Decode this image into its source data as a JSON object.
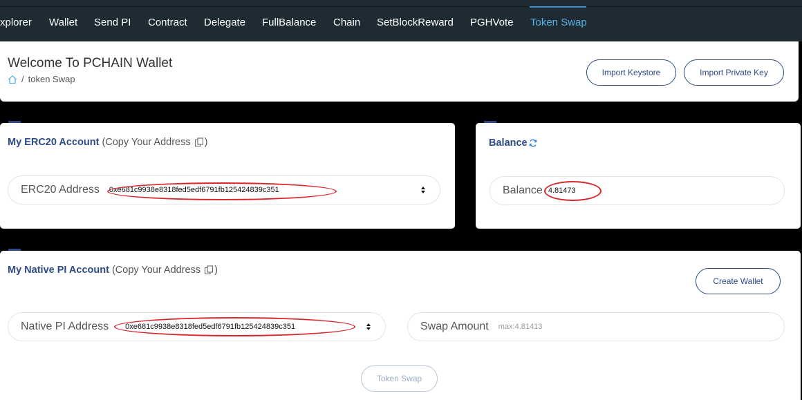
{
  "nav": {
    "items": [
      "xplorer",
      "Wallet",
      "Send PI",
      "Contract",
      "Delegate",
      "FullBalance",
      "Chain",
      "SetBlockReward",
      "PGHVote",
      "Token Swap"
    ],
    "active": "Token Swap"
  },
  "header": {
    "title": "Welcome To PCHAIN Wallet",
    "breadcrumb_sep": "/",
    "breadcrumb": "token Swap",
    "import_keystore": "Import Keystore",
    "import_private_key": "Import Private Key"
  },
  "erc20": {
    "title_strong": "My ERC20 Account",
    "title_open": "(Copy Your Address",
    "title_close": ")",
    "field_label": "ERC20 Address",
    "address": "0xe681c9938e8318fed5edf6791fb125424839c351"
  },
  "balance": {
    "title": "Balance",
    "field_label": "Balance",
    "value": "4.81473"
  },
  "native": {
    "title_strong": "My Native PI Account",
    "title_open": "(Copy Your Address",
    "title_close": ")",
    "create_wallet": "Create Wallet",
    "field_label": "Native PI Address",
    "address": "0xe681c9938e8318fed5edf6791fb125424839c351",
    "swap_label": "Swap Amount",
    "swap_placeholder": "max:4.81413",
    "swap_button": "Token Swap"
  },
  "colors": {
    "nav_bg": "#1e2b33",
    "accent": "#2d4a86",
    "nav_active": "#56b0e6",
    "highlight_ring": "#d9262c"
  }
}
